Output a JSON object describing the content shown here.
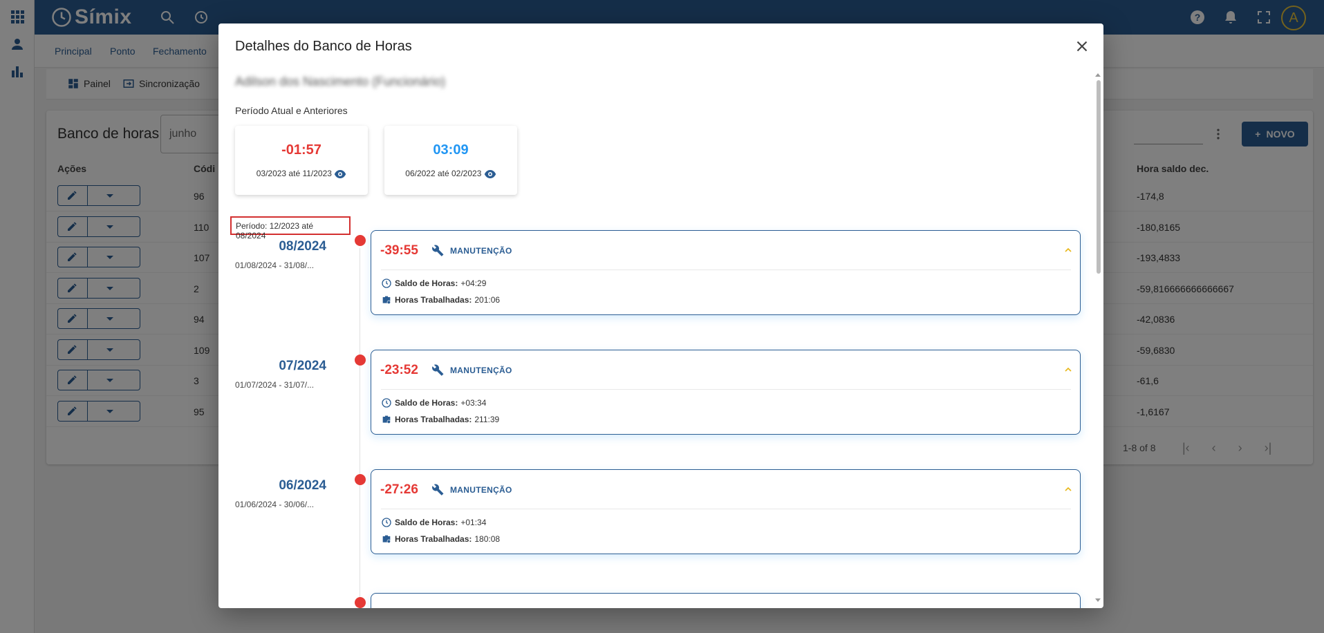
{
  "app": {
    "logo": "Símix",
    "avatar_letter": "A"
  },
  "menu": {
    "principal": "Principal",
    "ponto": "Ponto",
    "fechamento": "Fechamento"
  },
  "subbar": {
    "painel": "Painel",
    "sincronizacao": "Sincronização"
  },
  "page": {
    "title": "Banco de horas",
    "month_value": "junho",
    "novo_label": "NOVO",
    "columns": {
      "acoes": "Ações",
      "codigo": "Códi",
      "hora_saldo_dec": "Hora saldo dec."
    },
    "rows": [
      {
        "codigo": "96",
        "hora_saldo_dec": "-174,8"
      },
      {
        "codigo": "110",
        "hora_saldo_dec": "-180,8165"
      },
      {
        "codigo": "107",
        "hora_saldo_dec": "-193,4833"
      },
      {
        "codigo": "2",
        "hora_saldo_dec": "-59,816666666666667"
      },
      {
        "codigo": "94",
        "hora_saldo_dec": "-42,0836"
      },
      {
        "codigo": "109",
        "hora_saldo_dec": "-59,6830"
      },
      {
        "codigo": "3",
        "hora_saldo_dec": "-61,6"
      },
      {
        "codigo": "95",
        "hora_saldo_dec": "-1,6167"
      }
    ],
    "pager": "1-8 of 8"
  },
  "modal": {
    "title": "Detalhes do Banco de Horas",
    "employee_name_blurred": "Adilson dos Nascimento (Funcionário)",
    "periodo_label": "Período Atual e Anteriores",
    "summary": [
      {
        "value": "-01:57",
        "range": "03/2023 até 11/2023"
      },
      {
        "value": "03:09",
        "range": "06/2022 até 02/2023"
      }
    ],
    "period_highlight": "Período: 12/2023 até 08/2024",
    "entries": [
      {
        "month": "08/2024",
        "range": "01/08/2024 - 31/08/...",
        "value": "-39:55",
        "tag": "MANUTENÇÃO",
        "saldo_label": "Saldo de Horas:",
        "saldo": "+04:29",
        "trab_label": "Horas Trabalhadas:",
        "trab": "201:06"
      },
      {
        "month": "07/2024",
        "range": "01/07/2024 - 31/07/...",
        "value": "-23:52",
        "tag": "MANUTENÇÃO",
        "saldo_label": "Saldo de Horas:",
        "saldo": "+03:34",
        "trab_label": "Horas Trabalhadas:",
        "trab": "211:39"
      },
      {
        "month": "06/2024",
        "range": "01/06/2024 - 30/06/...",
        "value": "-27:26",
        "tag": "MANUTENÇÃO",
        "saldo_label": "Saldo de Horas:",
        "saldo": "+01:34",
        "trab_label": "Horas Trabalhadas:",
        "trab": "180:08"
      }
    ]
  },
  "colors": {
    "primary": "#2b5d93",
    "negative": "#e53935",
    "positive": "#2196f3",
    "chevron": "#e8b71a"
  }
}
